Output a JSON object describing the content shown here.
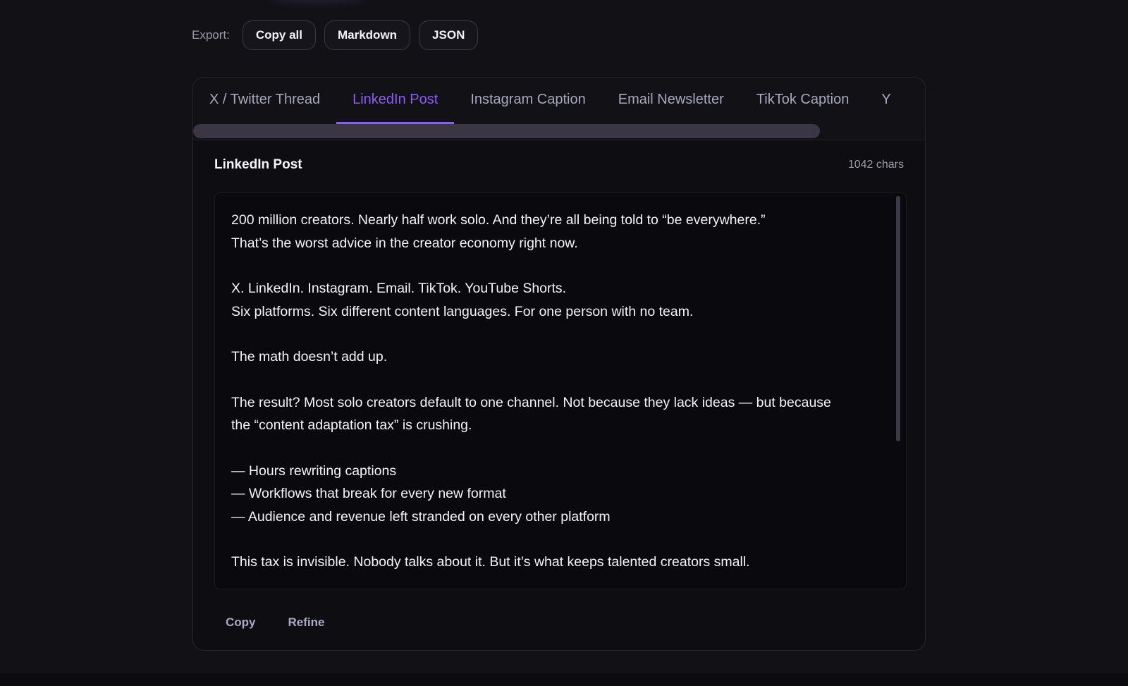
{
  "export": {
    "label": "Export:",
    "buttons": [
      "Copy all",
      "Markdown",
      "JSON"
    ]
  },
  "tabs": [
    {
      "label": "X / Twitter Thread",
      "active": false
    },
    {
      "label": "LinkedIn Post",
      "active": true
    },
    {
      "label": "Instagram Caption",
      "active": false
    },
    {
      "label": "Email Newsletter",
      "active": false
    },
    {
      "label": "TikTok Caption",
      "active": false
    },
    {
      "label": "Y",
      "active": false
    }
  ],
  "panel": {
    "title": "LinkedIn Post",
    "char_count": "1042 chars",
    "paragraphs": [
      [
        "200 million creators. Nearly half work solo. And they’re all being told to “be everywhere.”",
        "That’s the worst advice in the creator economy right now."
      ],
      [
        "X. LinkedIn. Instagram. Email. TikTok. YouTube Shorts.",
        "Six platforms. Six different content languages. For one person with no team."
      ],
      [
        "The math doesn’t add up."
      ],
      [
        "The result? Most solo creators default to one channel. Not because they lack ideas — but because",
        "the “content adaptation tax” is crushing."
      ],
      [
        "— Hours rewriting captions",
        "— Workflows that break for every new format",
        "— Audience and revenue left stranded on every other platform"
      ],
      [
        "This tax is invisible. Nobody talks about it. But it’s what keeps talented creators small."
      ]
    ]
  },
  "actions": {
    "copy": "Copy",
    "refine": "Refine"
  },
  "colors": {
    "background": "#111116",
    "accent": "#8b5cf6",
    "tab_inactive": "#a7a7bd",
    "text": "#f3f3f8"
  }
}
